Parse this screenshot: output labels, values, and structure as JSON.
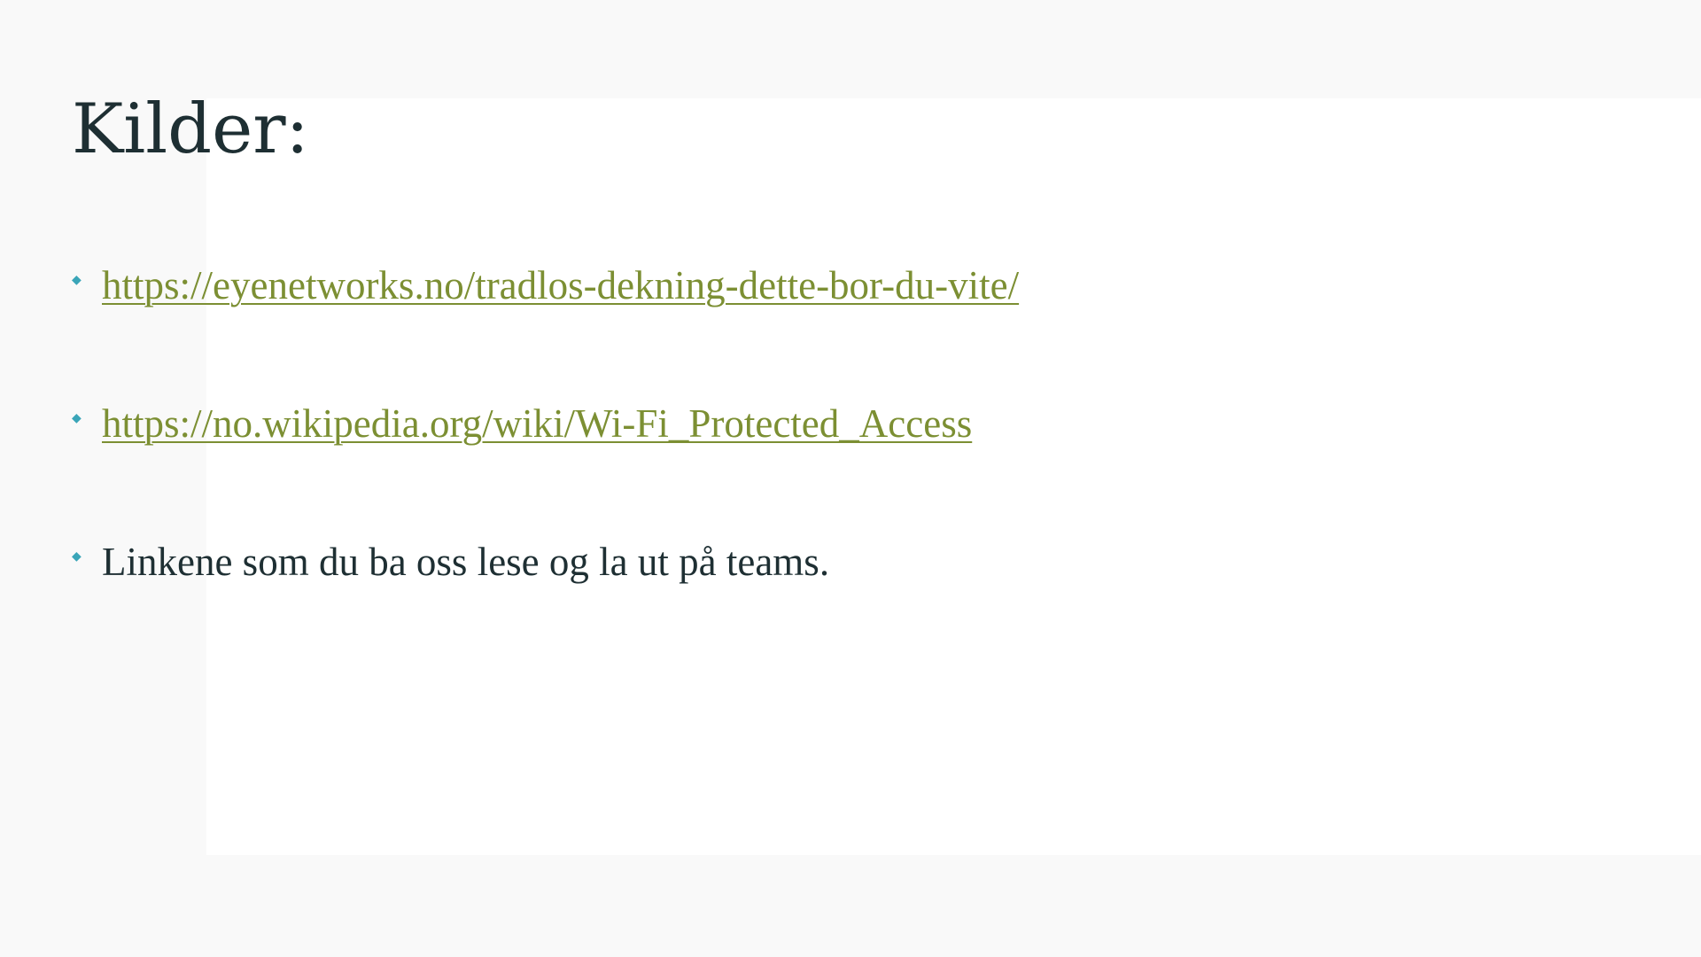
{
  "slide": {
    "title": "Kilder:",
    "bullets": [
      {
        "text": "https://eyenetworks.no/tradlos-dekning-dette-bor-du-vite/",
        "is_link": true
      },
      {
        "text": "https://no.wikipedia.org/wiki/Wi-Fi_Protected_Access",
        "is_link": true
      },
      {
        "text": "Linkene som du ba oss lese og la ut på teams.",
        "is_link": false
      }
    ]
  },
  "colors": {
    "title": "#1e2f33",
    "link": "#7c8f33",
    "bullet_marker": "#3aa5b8",
    "background": "#f9f9f9",
    "panel": "#ffffff"
  },
  "icons": {
    "bullet_marker": "bullet-diamond-icon"
  }
}
